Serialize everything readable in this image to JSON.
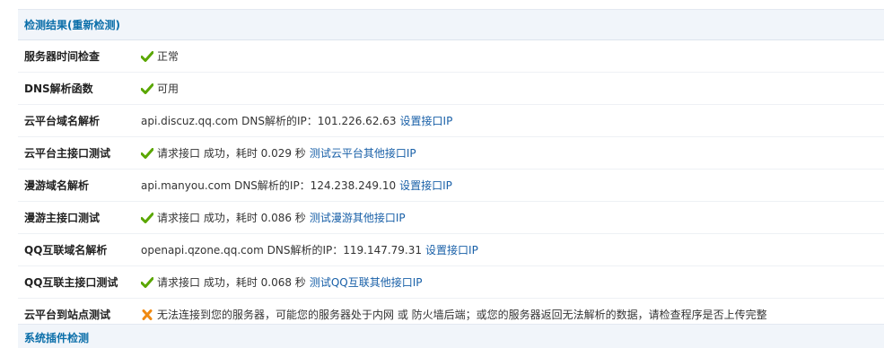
{
  "header": {
    "title": "检测结果(重新检测)"
  },
  "rows": [
    {
      "label": "服务器时间检查",
      "status": "ok",
      "text": "正常",
      "link": ""
    },
    {
      "label": "DNS解析函数",
      "status": "ok",
      "text": "可用",
      "link": ""
    },
    {
      "label": "云平台域名解析",
      "status": "none",
      "text": "api.discuz.qq.com DNS解析的IP：101.226.62.63",
      "link": "设置接口IP"
    },
    {
      "label": "云平台主接口测试",
      "status": "ok",
      "text": "请求接口 成功，耗时 0.029 秒",
      "link": "测试云平台其他接口IP"
    },
    {
      "label": "漫游域名解析",
      "status": "none",
      "text": "api.manyou.com DNS解析的IP：124.238.249.10",
      "link": "设置接口IP"
    },
    {
      "label": "漫游主接口测试",
      "status": "ok",
      "text": "请求接口 成功，耗时 0.086 秒",
      "link": "测试漫游其他接口IP"
    },
    {
      "label": "QQ互联域名解析",
      "status": "none",
      "text": "openapi.qzone.qq.com DNS解析的IP：119.147.79.31",
      "link": "设置接口IP"
    },
    {
      "label": "QQ互联主接口测试",
      "status": "ok",
      "text": "请求接口 成功，耗时 0.068 秒",
      "link": "测试QQ互联其他接口IP"
    },
    {
      "label": "云平台到站点测试",
      "status": "error",
      "text": "无法连接到您的服务器，可能您的服务器处于内网 或 防火墙后端；或您的服务器返回无法解析的数据，请检查程序是否上传完整",
      "link": ""
    }
  ],
  "next_section": {
    "title": "系统插件检测"
  },
  "colors": {
    "header_text": "#0a6ea9",
    "header_bg": "#f1f5fa",
    "link": "#1960a8",
    "ok": "#5aa700",
    "error": "#f08a12"
  },
  "icons": {
    "ok": "check-icon",
    "error": "cross-icon"
  }
}
